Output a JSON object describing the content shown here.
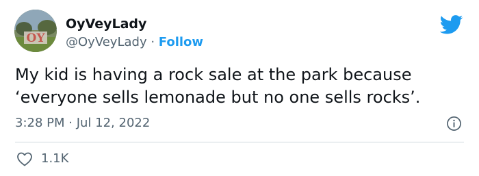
{
  "author": {
    "name": "OyVeyLady",
    "handle": "@OyVeyLady",
    "separator": " · ",
    "follow_label": "Follow",
    "avatar_text": "OY"
  },
  "tweet": {
    "lines": [
      "My kid is having a rock sale at the park because",
      "‘everyone sells lemonade but no one sells rocks’."
    ]
  },
  "meta": {
    "time": "3:28 PM",
    "separator": " · ",
    "date": "Jul 12, 2022"
  },
  "actions": {
    "like_count": "1.1K"
  },
  "icons": {
    "logo": "twitter-bird-icon",
    "info": "info-icon",
    "like": "heart-icon"
  },
  "colors": {
    "brand": "#1d9bf0",
    "text": "#0f1419",
    "secondary": "#536471",
    "divider": "#cfd9de"
  }
}
